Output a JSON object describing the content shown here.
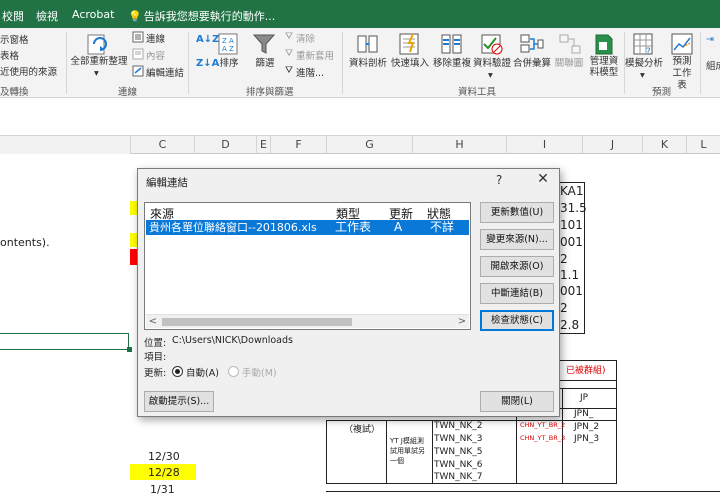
{
  "tabs": [
    "校閱",
    "檢視",
    "Acrobat"
  ],
  "tell_me": "告訴我您想要執行的動作...",
  "ribbon": {
    "left_items": [
      "示窗格",
      "表格",
      "近使用的來源"
    ],
    "left_group": "及轉換",
    "refresh_all": "全部重新整理",
    "connections": "連線",
    "properties": "內容",
    "edit_links": "編輯連結",
    "connections_group": "連線",
    "sort": "排序",
    "filter": "篩選",
    "clear": "清除",
    "reapply": "重新套用",
    "advanced": "進階...",
    "sort_filter_group": "排序與篩選",
    "text_to_columns": "資料剖析",
    "flash_fill": "快速填入",
    "remove_duplicates": "移除重複",
    "data_validation": "資料驗證",
    "consolidate": "合併彙算",
    "relationships": "關聯圖",
    "manage_model": "管理資料模型",
    "data_tools_group": "資料工具",
    "what_if": "模擬分析",
    "forecast_sheet": "預測工作表",
    "forecast_group": "預測",
    "group_partial": "組成"
  },
  "columns": [
    "C",
    "D",
    "E",
    "F",
    "G",
    "H",
    "I",
    "J",
    "K",
    "L"
  ],
  "sheet": {
    "left_text": "ontents).",
    "right_col_values": [
      "KA1",
      "31.5",
      "101",
      "001",
      "2",
      "1.1",
      "001",
      "2",
      "2.8"
    ],
    "date1": "12/30",
    "date2": "12/28",
    "date3": "1/31",
    "table_label_1": "已被群組)",
    "table_trial": "（複試）",
    "table_note": "YT J模組測試用單試另一個",
    "twn_items": [
      "TWN_NK_2",
      "TWN_NK_3",
      "TWN_NK_5",
      "TWN_NK_6",
      "TWN_NK_7"
    ],
    "chn_items": [
      "CHN_YT_BR_2",
      "CHN_YT_BR_3"
    ],
    "jp_header": "JP",
    "jp_items": [
      "JPN_",
      "JPN_2",
      "JPN_3"
    ]
  },
  "dialog": {
    "title": "編輯連結",
    "help": "?",
    "close": "✕",
    "headers": {
      "source": "來源",
      "type": "類型",
      "update": "更新",
      "status": "狀態"
    },
    "row": {
      "source": "貴州各單位聯絡窗口--201806.xls",
      "type": "工作表",
      "update": "A",
      "status": "不詳"
    },
    "buttons": {
      "update_values": "更新數值(U)",
      "change_source": "變更來源(N)...",
      "open_source": "開啟來源(O)",
      "break_link": "中斷連結(B)",
      "check_status": "檢查狀態(C)"
    },
    "location_label": "位置:",
    "location_value": "C:\\Users\\NICK\\Downloads",
    "item_label": "項目:",
    "update_label": "更新:",
    "auto": "自動(A)",
    "manual": "手動(M)",
    "startup_prompt": "啟動提示(S)...",
    "close_button": "關閉(L)"
  },
  "colors": {
    "excel_green": "#217346",
    "selection_blue": "#0a78d7",
    "highlight_yellow": "#ffff00",
    "fill_red": "#ff0000"
  }
}
